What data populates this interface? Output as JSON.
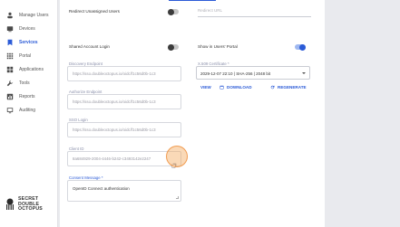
{
  "sidebar": {
    "items": [
      {
        "label": "Manage Users",
        "icon": "users-icon"
      },
      {
        "label": "Devices",
        "icon": "device-icon"
      },
      {
        "label": "Services",
        "icon": "bookmark-icon",
        "active": true
      },
      {
        "label": "Portal",
        "icon": "grid-icon"
      },
      {
        "label": "Applications",
        "icon": "apps-icon"
      },
      {
        "label": "Tools",
        "icon": "wrench-icon"
      },
      {
        "label": "Reports",
        "icon": "chart-icon"
      },
      {
        "label": "Auditing",
        "icon": "monitor-icon"
      }
    ],
    "brand": {
      "line1": "SECRET",
      "line2": "DOUBLE",
      "line3": "OCTOPUS"
    }
  },
  "settings": {
    "redirect_unassigned": {
      "label": "Redirect Unassigned Users",
      "on": false
    },
    "redirect_url_placeholder": "Redirect URL",
    "shared_account_login": {
      "label": "Shared Account Login",
      "on": false
    },
    "show_in_users_portal": {
      "label": "Show in Users' Portal",
      "on": true
    }
  },
  "fields": {
    "discovery_endpoint": {
      "label": "Discovery Endpoint",
      "value": "https://sso.doubleoctopus.io/oidc/f1c56d0b-1c3"
    },
    "authorize_endpoint": {
      "label": "Authorize Endpoint",
      "value": "https://sso.doubleoctopus.io/oidc/f1c56d0b-1c3"
    },
    "sso_login": {
      "label": "SSO Login",
      "value": "https://sso.doubleoctopus.io/oidc/f1c56d0b-1c3"
    },
    "client_id": {
      "label": "Client ID",
      "value": "8a684929-2004-4446-b242-c3493142e2247"
    },
    "consent_message": {
      "label": "Consent Message *",
      "value": "OpenID Connect authentication"
    }
  },
  "certificate": {
    "label": "X.509 Certificate *",
    "value": "2029-12-07 22:10 | SHA-256 | 2048 bit",
    "view_label": "VIEW",
    "download_label": "DOWNLOAD",
    "regenerate_label": "REGENERATE"
  },
  "colors": {
    "accent": "#2b5bd7",
    "highlight": "#f4aa60"
  }
}
